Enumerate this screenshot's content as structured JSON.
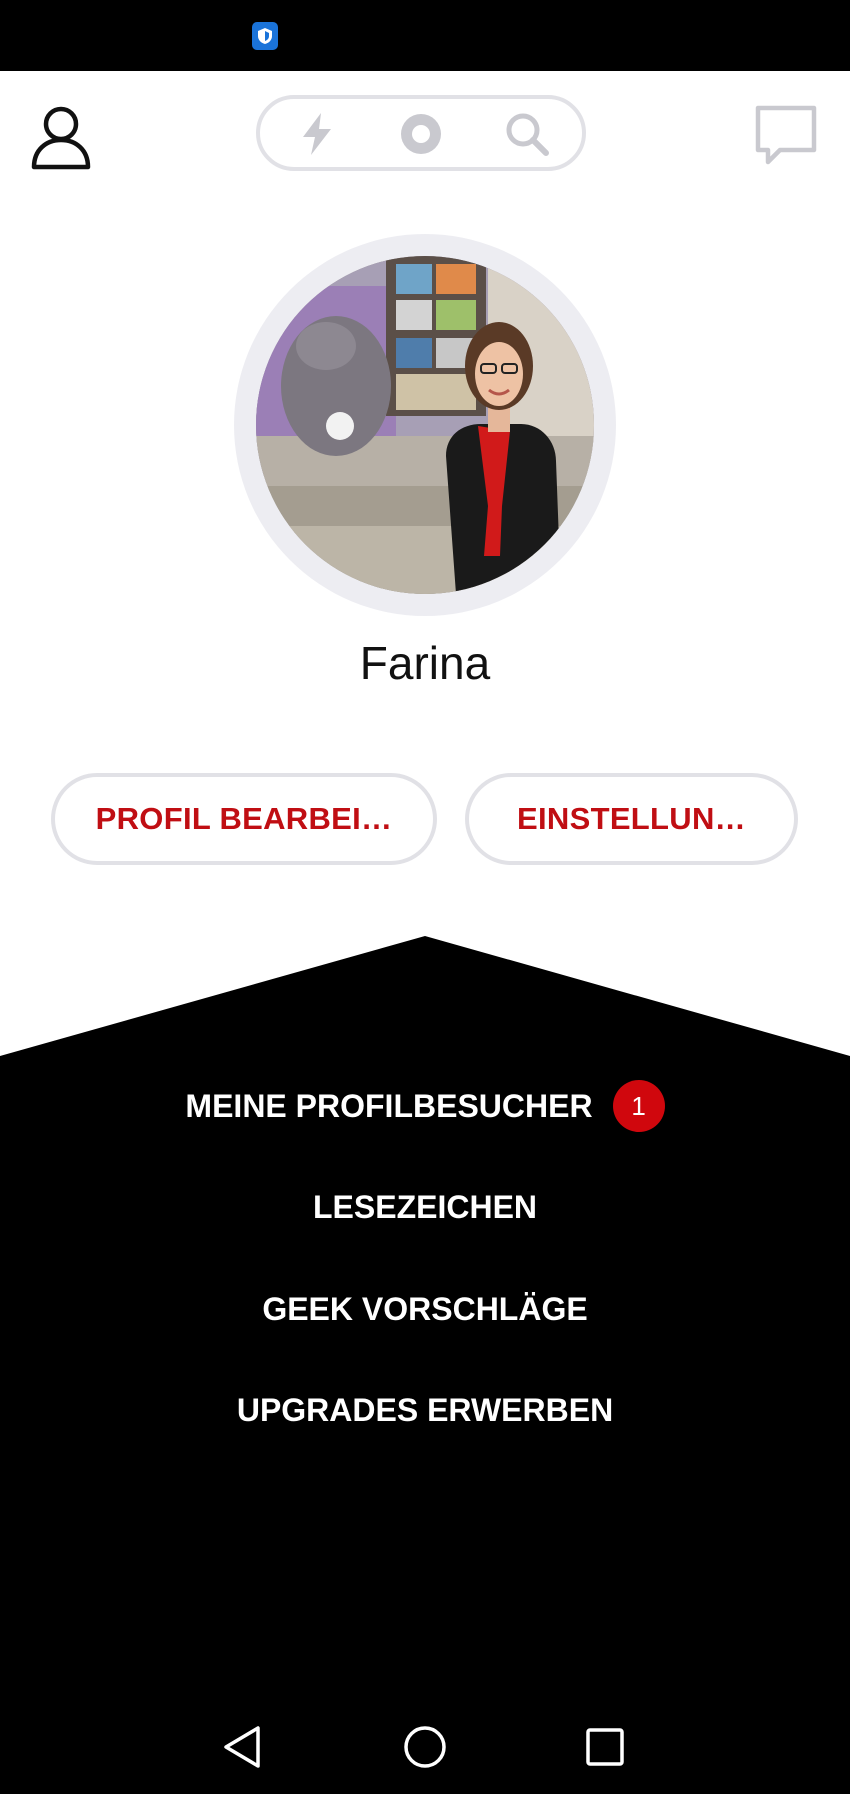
{
  "status_bar": {
    "icon": "shield-icon",
    "icon_color": "#1a73d9"
  },
  "header": {
    "profile_icon": "user-icon",
    "modes": [
      "lightning-icon",
      "circle-icon",
      "search-icon"
    ],
    "chat_icon": "chat-icon"
  },
  "profile": {
    "avatar": "profile-photo",
    "name": "Farina"
  },
  "actions": {
    "edit_profile": "PROFIL BEARBEI…",
    "settings": "EINSTELLUN…"
  },
  "menu": {
    "visitors": {
      "label": "MEINE PROFILBESUCHER",
      "badge": "1"
    },
    "bookmarks": "LESEZEICHEN",
    "suggestions": "GEEK VORSCHLÄGE",
    "upgrades": "UPGRADES ERWERBEN"
  },
  "nav": [
    "back-icon",
    "home-icon",
    "recents-icon"
  ],
  "colors": {
    "accent": "#c00e13",
    "badge": "#d0070d",
    "panel": "#000000"
  }
}
